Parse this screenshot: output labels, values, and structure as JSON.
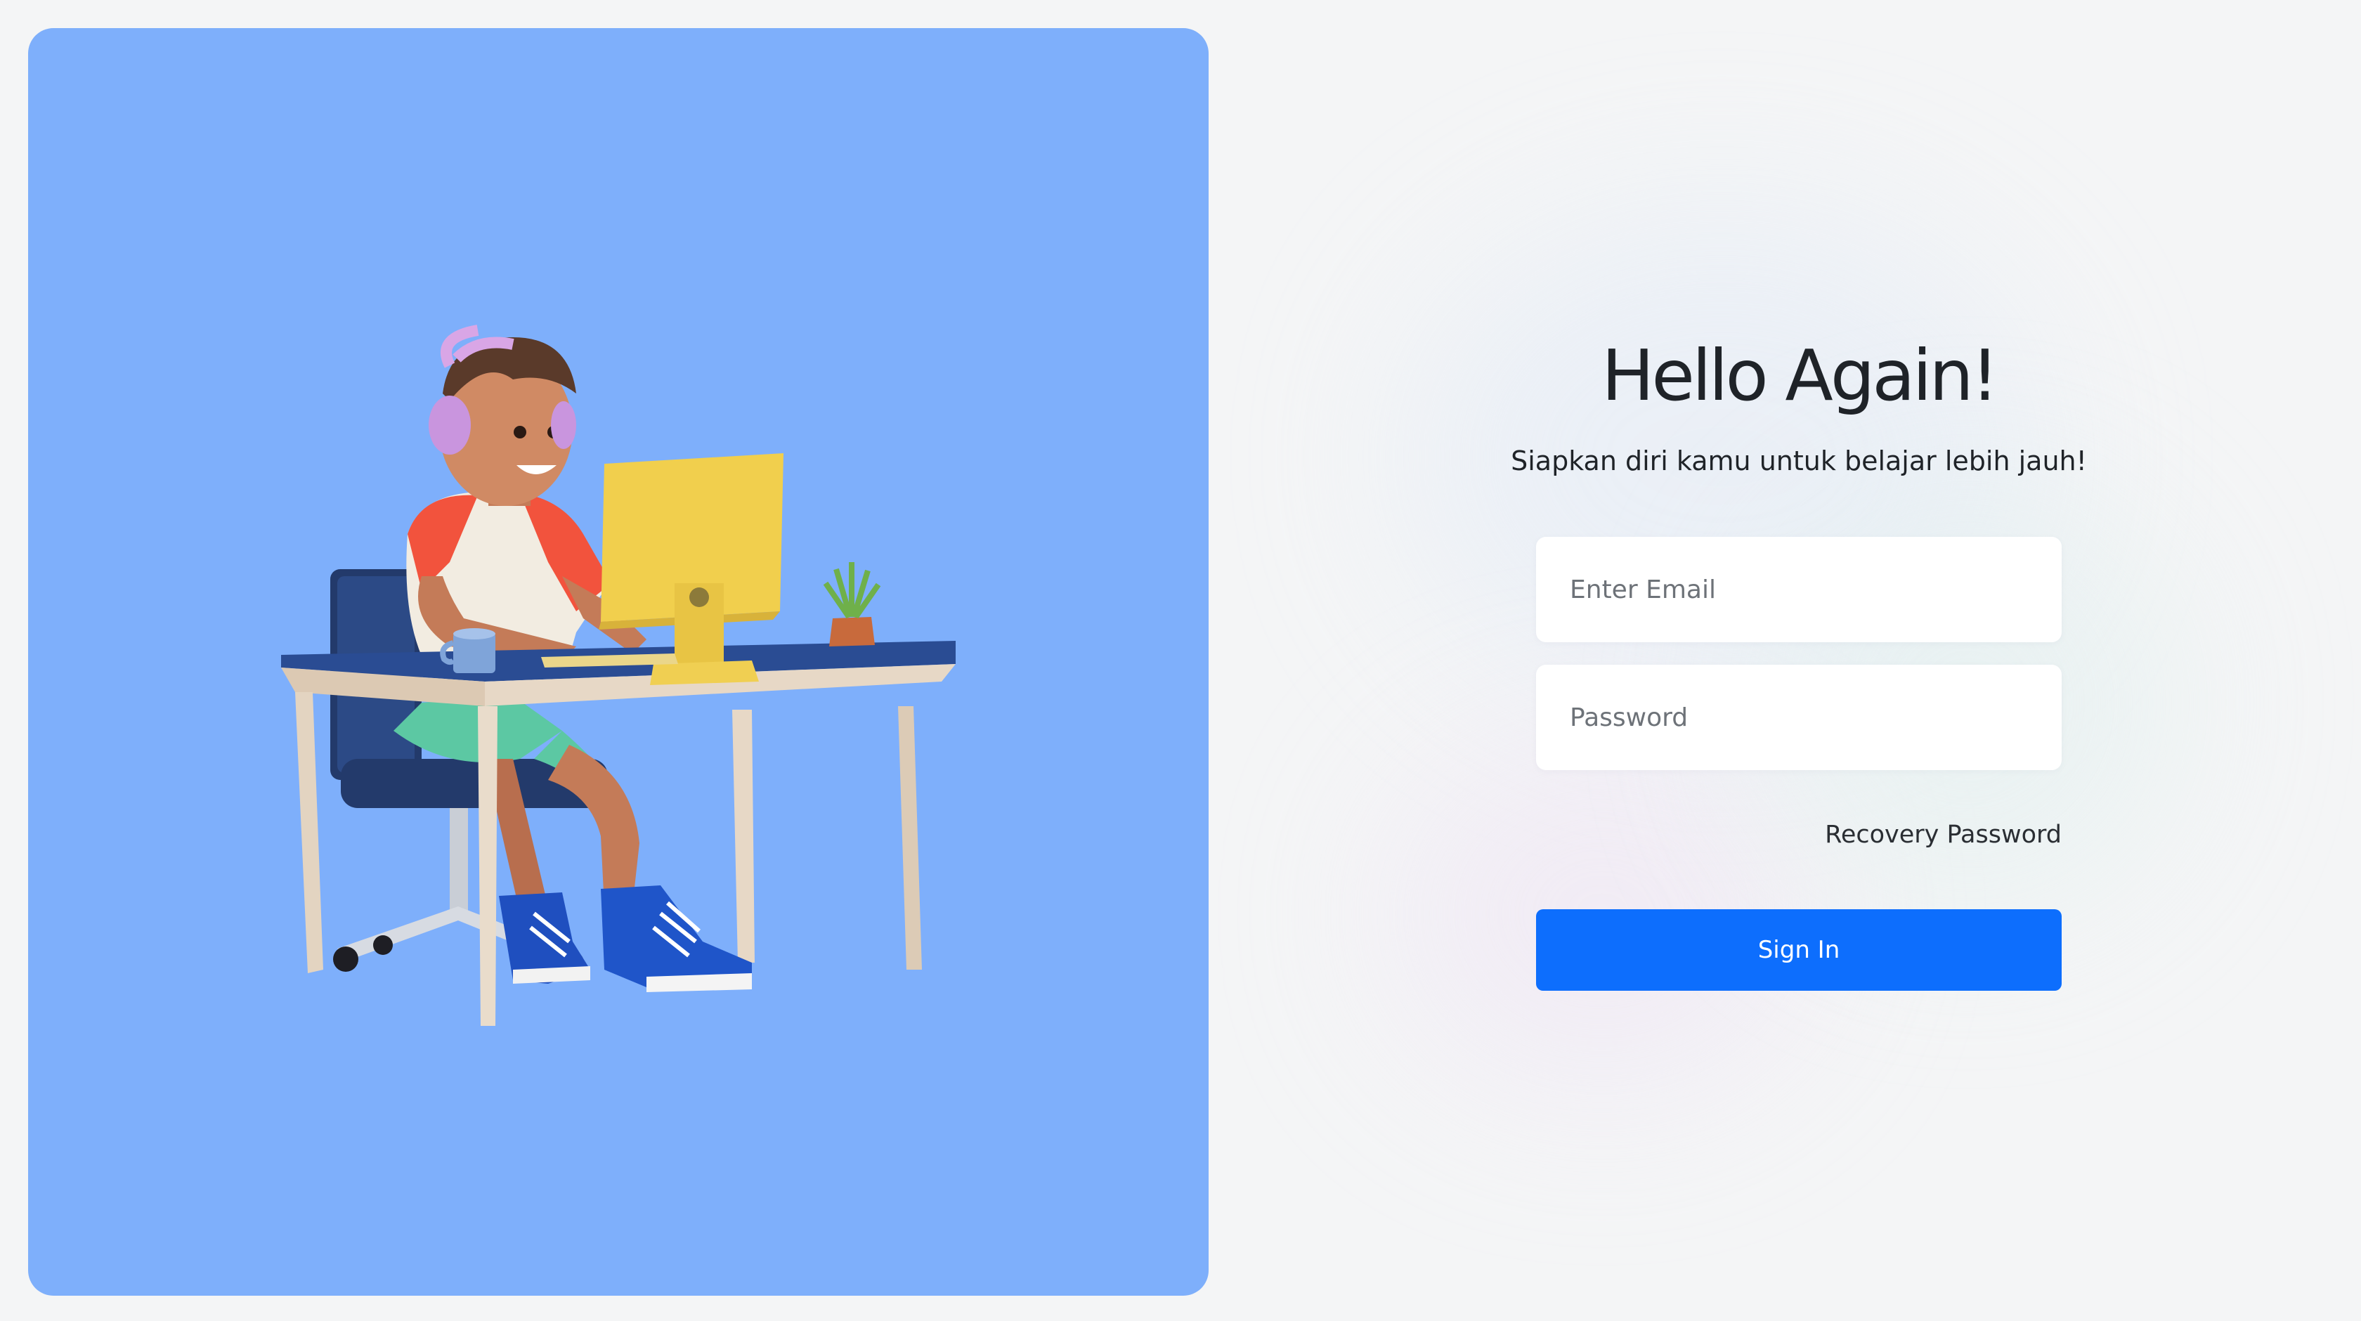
{
  "login": {
    "title": "Hello Again!",
    "subtitle": "Siapkan diri kamu untuk belajar lebih jauh!",
    "email_placeholder": "Enter Email",
    "password_placeholder": "Password",
    "recovery_link": "Recovery Password",
    "signin_label": "Sign In"
  },
  "hero": {
    "illustration": "person-at-desk-with-computer-illustration"
  },
  "colors": {
    "panel": "#7eaffb",
    "button": "#0d6efd",
    "background": "#f4f5f6",
    "text": "#1f2328"
  }
}
